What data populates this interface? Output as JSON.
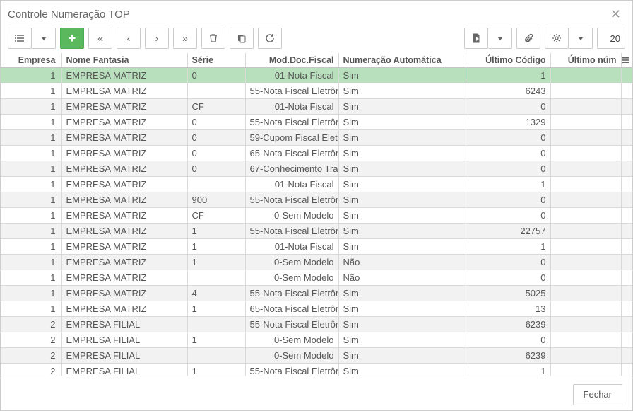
{
  "window": {
    "title": "Controle Numeração TOP"
  },
  "toolbar": {
    "page_value": "20"
  },
  "footer": {
    "close_label": "Fechar"
  },
  "columns": {
    "empresa": "Empresa",
    "nome_fantasia": "Nome Fantasia",
    "serie": "Série",
    "mod_doc_fiscal": "Mod.Doc.Fiscal",
    "numeracao_automatica": "Numeração Automática",
    "ultimo_codigo": "Último Código",
    "ultimo_num": "Último núm"
  },
  "rows": [
    {
      "empresa": "1",
      "nome": "EMPRESA MATRIZ",
      "serie": "0",
      "mod": "01-Nota Fiscal",
      "auto": "Sim",
      "ultimo": "1",
      "ultn": ""
    },
    {
      "empresa": "1",
      "nome": "EMPRESA MATRIZ",
      "serie": "",
      "mod": "55-Nota Fiscal Eletrôn",
      "auto": "Sim",
      "ultimo": "6243",
      "ultn": ""
    },
    {
      "empresa": "1",
      "nome": "EMPRESA MATRIZ",
      "serie": "CF",
      "mod": "01-Nota Fiscal",
      "auto": "Sim",
      "ultimo": "0",
      "ultn": ""
    },
    {
      "empresa": "1",
      "nome": "EMPRESA MATRIZ",
      "serie": "0",
      "mod": "55-Nota Fiscal Eletrôn",
      "auto": "Sim",
      "ultimo": "1329",
      "ultn": ""
    },
    {
      "empresa": "1",
      "nome": "EMPRESA MATRIZ",
      "serie": "0",
      "mod": "59-Cupom Fiscal Elet",
      "auto": "Sim",
      "ultimo": "0",
      "ultn": ""
    },
    {
      "empresa": "1",
      "nome": "EMPRESA MATRIZ",
      "serie": "0",
      "mod": "65-Nota Fiscal Eletrôn",
      "auto": "Sim",
      "ultimo": "0",
      "ultn": ""
    },
    {
      "empresa": "1",
      "nome": "EMPRESA MATRIZ",
      "serie": "0",
      "mod": "67-Conhecimento Tra",
      "auto": "Sim",
      "ultimo": "0",
      "ultn": ""
    },
    {
      "empresa": "1",
      "nome": "EMPRESA MATRIZ",
      "serie": "",
      "mod": "01-Nota Fiscal",
      "auto": "Sim",
      "ultimo": "1",
      "ultn": ""
    },
    {
      "empresa": "1",
      "nome": "EMPRESA MATRIZ",
      "serie": "900",
      "mod": "55-Nota Fiscal Eletrôn",
      "auto": "Sim",
      "ultimo": "0",
      "ultn": ""
    },
    {
      "empresa": "1",
      "nome": "EMPRESA MATRIZ",
      "serie": "CF",
      "mod": "0-Sem Modelo",
      "auto": "Sim",
      "ultimo": "0",
      "ultn": ""
    },
    {
      "empresa": "1",
      "nome": "EMPRESA MATRIZ",
      "serie": "1",
      "mod": "55-Nota Fiscal Eletrôn",
      "auto": "Sim",
      "ultimo": "22757",
      "ultn": ""
    },
    {
      "empresa": "1",
      "nome": "EMPRESA MATRIZ",
      "serie": "1",
      "mod": "01-Nota Fiscal",
      "auto": "Sim",
      "ultimo": "1",
      "ultn": ""
    },
    {
      "empresa": "1",
      "nome": "EMPRESA MATRIZ",
      "serie": "1",
      "mod": "0-Sem Modelo",
      "auto": "Não",
      "ultimo": "0",
      "ultn": ""
    },
    {
      "empresa": "1",
      "nome": "EMPRESA MATRIZ",
      "serie": "",
      "mod": "0-Sem Modelo",
      "auto": "Não",
      "ultimo": "0",
      "ultn": ""
    },
    {
      "empresa": "1",
      "nome": "EMPRESA MATRIZ",
      "serie": "4",
      "mod": "55-Nota Fiscal Eletrôn",
      "auto": "Sim",
      "ultimo": "5025",
      "ultn": ""
    },
    {
      "empresa": "1",
      "nome": "EMPRESA MATRIZ",
      "serie": "1",
      "mod": "65-Nota Fiscal Eletrôn",
      "auto": "Sim",
      "ultimo": "13",
      "ultn": ""
    },
    {
      "empresa": "2",
      "nome": "EMPRESA FILIAL",
      "serie": "",
      "mod": "55-Nota Fiscal Eletrôn",
      "auto": "Sim",
      "ultimo": "6239",
      "ultn": ""
    },
    {
      "empresa": "2",
      "nome": "EMPRESA FILIAL",
      "serie": "1",
      "mod": "0-Sem Modelo",
      "auto": "Sim",
      "ultimo": "0",
      "ultn": ""
    },
    {
      "empresa": "2",
      "nome": "EMPRESA FILIAL",
      "serie": "",
      "mod": "0-Sem Modelo",
      "auto": "Sim",
      "ultimo": "6239",
      "ultn": ""
    },
    {
      "empresa": "2",
      "nome": "EMPRESA FILIAL",
      "serie": "1",
      "mod": "55-Nota Fiscal Eletrôn",
      "auto": "Sim",
      "ultimo": "1",
      "ultn": ""
    }
  ]
}
